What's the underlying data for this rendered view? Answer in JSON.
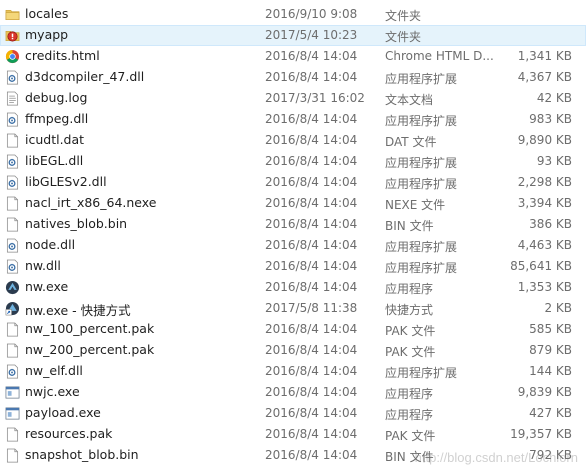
{
  "files": [
    {
      "icon": "folder-icon",
      "name": "locales",
      "date": "2016/9/10 9:08",
      "type": "文件夹",
      "size": ""
    },
    {
      "icon": "app-folder-icon",
      "name": "myapp",
      "date": "2017/5/4 10:23",
      "type": "文件夹",
      "size": "",
      "selected": true
    },
    {
      "icon": "chrome-html-icon",
      "name": "credits.html",
      "date": "2016/8/4 14:04",
      "type": "Chrome HTML D...",
      "size": "1,341 KB"
    },
    {
      "icon": "dll-icon",
      "name": "d3dcompiler_47.dll",
      "date": "2016/8/4 14:04",
      "type": "应用程序扩展",
      "size": "4,367 KB"
    },
    {
      "icon": "text-file-icon",
      "name": "debug.log",
      "date": "2017/3/31 16:02",
      "type": "文本文档",
      "size": "42 KB"
    },
    {
      "icon": "dll-icon",
      "name": "ffmpeg.dll",
      "date": "2016/8/4 14:04",
      "type": "应用程序扩展",
      "size": "983 KB"
    },
    {
      "icon": "file-icon",
      "name": "icudtl.dat",
      "date": "2016/8/4 14:04",
      "type": "DAT 文件",
      "size": "9,890 KB"
    },
    {
      "icon": "dll-icon",
      "name": "libEGL.dll",
      "date": "2016/8/4 14:04",
      "type": "应用程序扩展",
      "size": "93 KB"
    },
    {
      "icon": "dll-icon",
      "name": "libGLESv2.dll",
      "date": "2016/8/4 14:04",
      "type": "应用程序扩展",
      "size": "2,298 KB"
    },
    {
      "icon": "file-icon",
      "name": "nacl_irt_x86_64.nexe",
      "date": "2016/8/4 14:04",
      "type": "NEXE 文件",
      "size": "3,394 KB"
    },
    {
      "icon": "file-icon",
      "name": "natives_blob.bin",
      "date": "2016/8/4 14:04",
      "type": "BIN 文件",
      "size": "386 KB"
    },
    {
      "icon": "dll-icon",
      "name": "node.dll",
      "date": "2016/8/4 14:04",
      "type": "应用程序扩展",
      "size": "4,463 KB"
    },
    {
      "icon": "dll-icon",
      "name": "nw.dll",
      "date": "2016/8/4 14:04",
      "type": "应用程序扩展",
      "size": "85,641 KB"
    },
    {
      "icon": "nwjs-exe-icon",
      "name": "nw.exe",
      "date": "2016/8/4 14:04",
      "type": "应用程序",
      "size": "1,353 KB"
    },
    {
      "icon": "shortcut-icon",
      "name": "nw.exe - 快捷方式",
      "date": "2017/5/8 11:38",
      "type": "快捷方式",
      "size": "2 KB"
    },
    {
      "icon": "file-icon",
      "name": "nw_100_percent.pak",
      "date": "2016/8/4 14:04",
      "type": "PAK 文件",
      "size": "585 KB"
    },
    {
      "icon": "file-icon",
      "name": "nw_200_percent.pak",
      "date": "2016/8/4 14:04",
      "type": "PAK 文件",
      "size": "879 KB"
    },
    {
      "icon": "dll-icon",
      "name": "nw_elf.dll",
      "date": "2016/8/4 14:04",
      "type": "应用程序扩展",
      "size": "144 KB"
    },
    {
      "icon": "exe-icon",
      "name": "nwjc.exe",
      "date": "2016/8/4 14:04",
      "type": "应用程序",
      "size": "9,839 KB"
    },
    {
      "icon": "exe-icon",
      "name": "payload.exe",
      "date": "2016/8/4 14:04",
      "type": "应用程序",
      "size": "427 KB"
    },
    {
      "icon": "file-icon",
      "name": "resources.pak",
      "date": "2016/8/4 14:04",
      "type": "PAK 文件",
      "size": "19,357 KB"
    },
    {
      "icon": "file-icon",
      "name": "snapshot_blob.bin",
      "date": "2016/8/4 14:04",
      "type": "BIN 文件",
      "size": "792 KB"
    }
  ],
  "watermark": "http://blog.csdn.net/Lochlorn",
  "colors": {
    "selection_bg": "#e5f3fb",
    "folder": "#e8c35a",
    "name_text": "#1e1e1e",
    "meta_text": "#6d6d6d"
  }
}
